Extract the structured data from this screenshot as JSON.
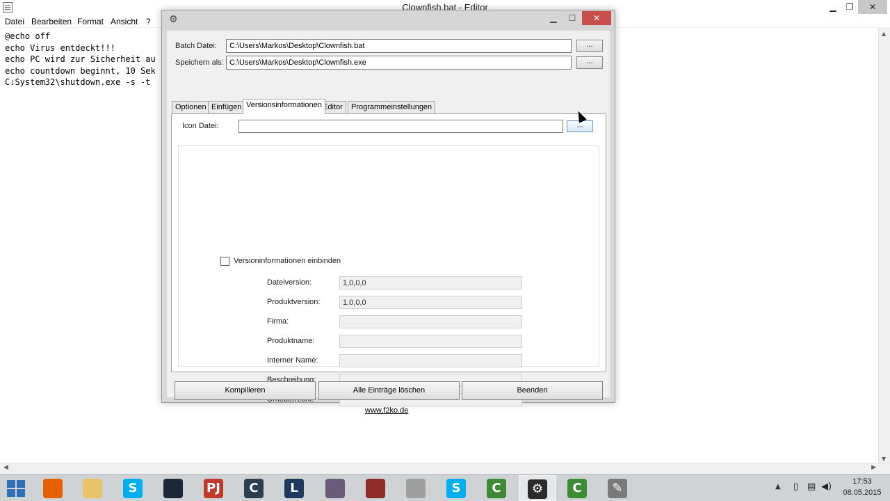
{
  "notepad": {
    "title": "Clownfish.bat - Editor",
    "menu": [
      "Datei",
      "Bearbeiten",
      "Format",
      "Ansicht",
      "?"
    ],
    "lines": [
      "@echo off",
      "echo Virus entdeckt!!!",
      "echo PC wird zur Sicherheit au",
      "echo countdown beginnt, 10 Sek",
      "C:System32\\shutdown.exe -s -t"
    ]
  },
  "dialog": {
    "title": "",
    "batch_label": "Batch Datei:",
    "batch_value": "C:\\Users\\Markos\\Desktop\\Clownfish.bat",
    "save_label": "Speichern als:",
    "save_value": "C:\\Users\\Markos\\Desktop\\Clownfish.exe",
    "browse_label": "...",
    "tabs": [
      "Optionen",
      "Einfügen",
      "Versionsinformationen",
      "Editor",
      "Programmeinstellungen"
    ],
    "active_tab": "Versionsinformationen",
    "icon_label": "Icon Datei:",
    "icon_value": "",
    "version_checkbox_label": "Versioninformationen einbinden",
    "version_checkbox_checked": false,
    "fields": [
      {
        "label": "Dateiversion:",
        "value": "1,0,0,0"
      },
      {
        "label": "Produktversion:",
        "value": "1,0,0,0"
      },
      {
        "label": "Firma:",
        "value": ""
      },
      {
        "label": "Produktname:",
        "value": ""
      },
      {
        "label": "Interner Name:",
        "value": ""
      },
      {
        "label": "Beschreibung:",
        "value": ""
      },
      {
        "label": "Urheberrecht:",
        "value": ""
      }
    ],
    "buttons": {
      "compile": "Kompilieren",
      "clear": "Alle Einträge löschen",
      "exit": "Beenden"
    },
    "link": "www.f2ko.de"
  },
  "taskbar": {
    "items": [
      {
        "name": "firefox",
        "glyph": "",
        "color": "#e66000"
      },
      {
        "name": "explorer",
        "glyph": "",
        "color": "#e8c36a"
      },
      {
        "name": "skype",
        "glyph": "S",
        "color": "#00aff0"
      },
      {
        "name": "steam",
        "glyph": "",
        "color": "#1b2838"
      },
      {
        "name": "app-pj",
        "glyph": "PJ",
        "color": "#c0392b"
      },
      {
        "name": "app-e",
        "glyph": "C",
        "color": "#2c3e50"
      },
      {
        "name": "league-of-legends",
        "glyph": "L",
        "color": "#1e3a5f"
      },
      {
        "name": "game-avatar-1",
        "glyph": "",
        "color": "#6b5b7b"
      },
      {
        "name": "game-avatar-2",
        "glyph": "",
        "color": "#8e2b2b"
      },
      {
        "name": "app-round",
        "glyph": "",
        "color": "#9e9e9e"
      },
      {
        "name": "skype-2",
        "glyph": "S",
        "color": "#00aff0"
      },
      {
        "name": "camtasia",
        "glyph": "C",
        "color": "#3d8b37"
      },
      {
        "name": "bat-converter",
        "glyph": "⚙",
        "color": "#2b2b2b"
      },
      {
        "name": "camtasia-2",
        "glyph": "C",
        "color": "#3d8b37"
      },
      {
        "name": "notepad",
        "glyph": "✎",
        "color": "#7a7a7a"
      }
    ],
    "active_index": 12,
    "time": "17:53",
    "date": "08.05.2015"
  }
}
